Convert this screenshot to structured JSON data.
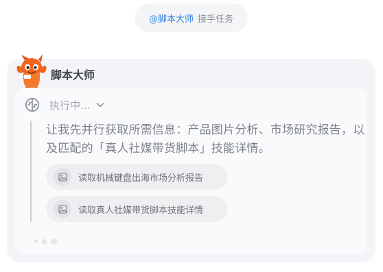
{
  "handoff": {
    "mention": "@脚本大师",
    "text": "接手任务"
  },
  "agent": {
    "name": "脚本大师",
    "avatar_icon": "orange-mascot-avatar"
  },
  "execution": {
    "status_icon": "brain-icon",
    "status_label": "执行中...",
    "expand_icon": "chevron-down-icon",
    "thought_text": "让我先并行获取所需信息：产品图片分析、市场研究报告，以及匹配的「真人社媒带货脚本」技能详情。",
    "tool_calls": [
      {
        "icon": "image-file-icon",
        "label": "读取机械键盘出海市场分析报告"
      },
      {
        "icon": "image-file-icon",
        "label": "读取真人社媒带货脚本技能详情"
      }
    ]
  },
  "colors": {
    "accent": "#2f7fe0",
    "avatar_orange": "#f0641e",
    "card_background": "#f3f4f7",
    "panel_background": "#f9fafc"
  }
}
